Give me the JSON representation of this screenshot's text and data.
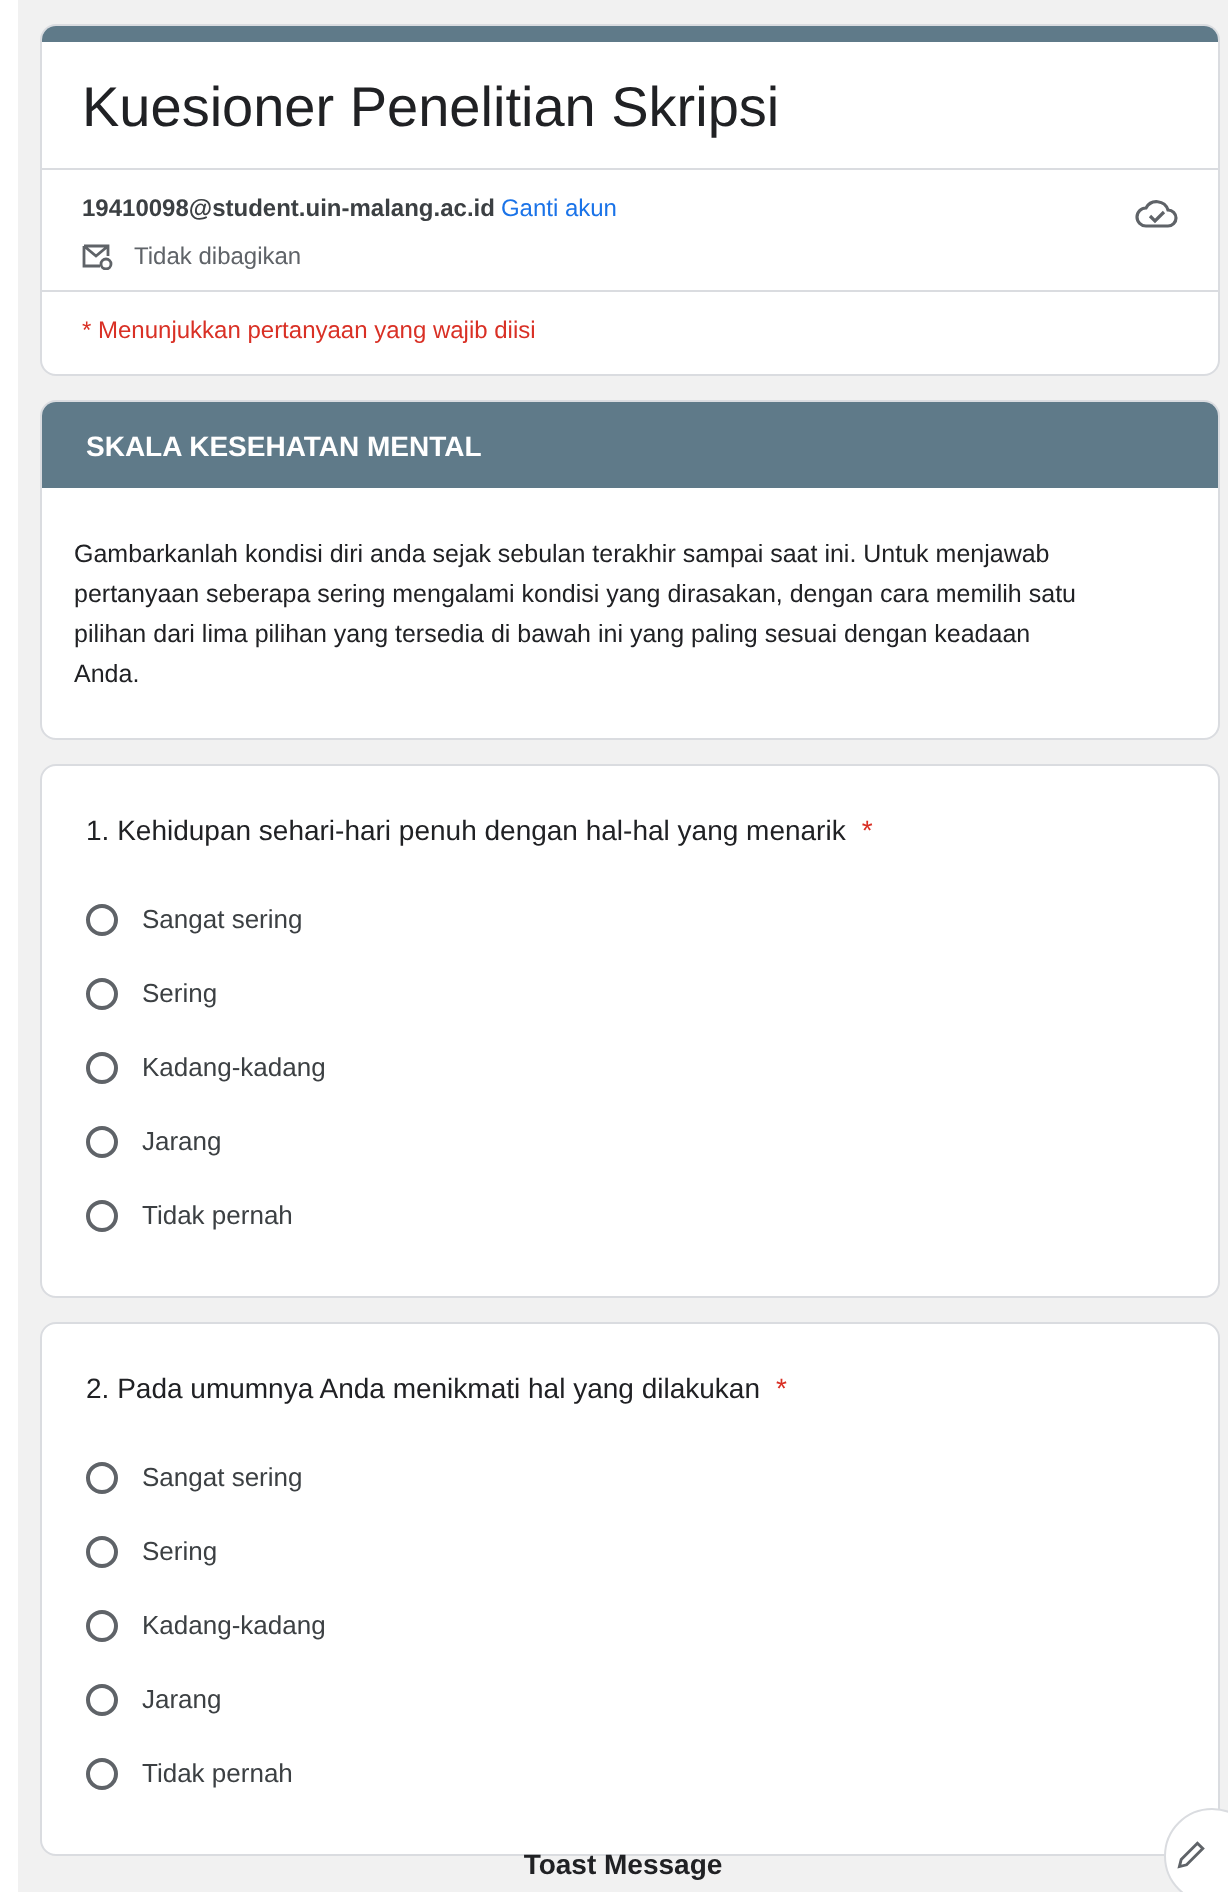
{
  "form": {
    "title": "Kuesioner Penelitian Skripsi",
    "account": "19410098@student.uin-malang.ac.id",
    "switch_account": "Ganti akun",
    "sharing": "Tidak dibagikan",
    "required_note": "* Menunjukkan pertanyaan yang wajib diisi"
  },
  "section": {
    "title": "SKALA KESEHATAN MENTAL",
    "description": "Gambarkanlah kondisi diri anda sejak sebulan terakhir sampai saat ini. Untuk menjawab pertanyaan seberapa sering mengalami kondisi yang dirasakan, dengan cara memilih satu pilihan dari lima pilihan yang tersedia di bawah ini yang paling sesuai dengan keadaan Anda."
  },
  "questions": [
    {
      "text": "1. Kehidupan sehari-hari penuh dengan hal-hal yang menarik",
      "required_mark": "*",
      "options": [
        {
          "label": "Sangat sering",
          "selected": false
        },
        {
          "label": "Sering",
          "selected": false
        },
        {
          "label": "Kadang-kadang",
          "selected": false
        },
        {
          "label": "Jarang",
          "selected": false
        },
        {
          "label": "Tidak pernah",
          "selected": false
        }
      ]
    },
    {
      "text": "2. Pada umumnya Anda menikmati hal yang dilakukan",
      "required_mark": "*",
      "options": [
        {
          "label": "Sangat sering",
          "selected": false
        },
        {
          "label": "Sering",
          "selected": false
        },
        {
          "label": "Kadang-kadang",
          "selected": false
        },
        {
          "label": "Jarang",
          "selected": false
        },
        {
          "label": "Tidak pernah",
          "selected": false
        }
      ]
    }
  ],
  "toast": "Toast Message"
}
